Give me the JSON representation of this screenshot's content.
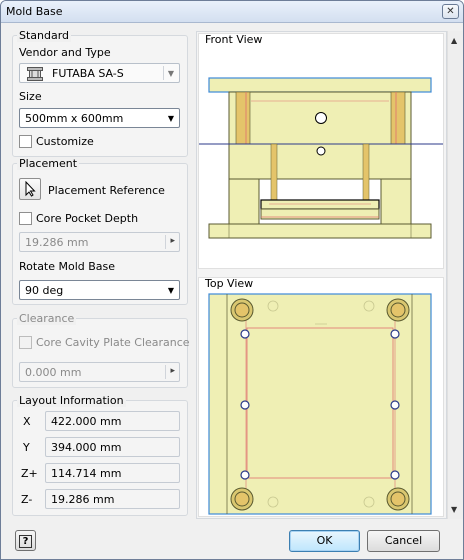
{
  "window": {
    "title": "Mold Base",
    "close_glyph": "✕"
  },
  "standard": {
    "group_label": "Standard",
    "vendor_label": "Vendor and Type",
    "vendor_value": "FUTABA SA-S",
    "vendor_icon": "mold-base-icon",
    "size_label": "Size",
    "size_value": "500mm x 600mm",
    "customize_label": "Customize",
    "customize_checked": false
  },
  "placement": {
    "group_label": "Placement",
    "reference_label": "Placement Reference",
    "core_pocket_label": "Core Pocket Depth",
    "core_pocket_checked": false,
    "core_pocket_value": "19.286 mm",
    "rotate_label": "Rotate Mold Base",
    "rotate_value": "90 deg"
  },
  "clearance": {
    "group_label": "Clearance",
    "core_cavity_label": "Core Cavity Plate Clearance",
    "core_cavity_checked": false,
    "core_cavity_value": "0.000 mm"
  },
  "layout": {
    "group_label": "Layout Information",
    "rows": [
      {
        "label": "X",
        "value": "422.000 mm"
      },
      {
        "label": "Y",
        "value": "394.000 mm"
      },
      {
        "label": "Z+",
        "value": "114.714 mm"
      },
      {
        "label": "Z-",
        "value": "19.286 mm"
      }
    ]
  },
  "views": {
    "front_label": "Front View",
    "top_label": "Top View"
  },
  "footer": {
    "help_glyph": "?",
    "ok_label": "OK",
    "cancel_label": "Cancel"
  },
  "colors": {
    "plate_fill": "#efefb4",
    "plate_stroke": "#5a5a30",
    "pillar": "#e4c46a",
    "red_line": "#e07070",
    "blue_line": "#3a66c8",
    "top_border": "#3c8ad8"
  }
}
